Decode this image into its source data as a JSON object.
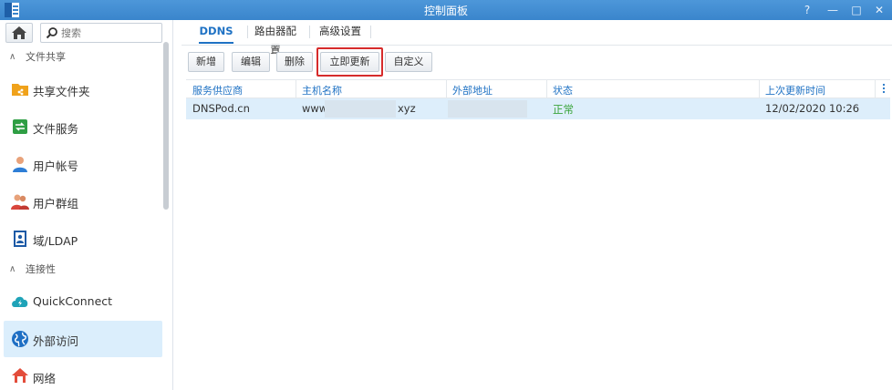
{
  "window": {
    "title": "控制面板",
    "controls": [
      "?",
      "—",
      "□",
      "✕"
    ]
  },
  "sidebar": {
    "search_placeholder": "搜索",
    "sections": [
      {
        "label": "文件共享"
      },
      {
        "label": "连接性"
      }
    ],
    "items": [
      {
        "label": "共享文件夹",
        "icon": "shared-folder-icon"
      },
      {
        "label": "文件服务",
        "icon": "file-services-icon"
      },
      {
        "label": "用户帐号",
        "icon": "user-icon"
      },
      {
        "label": "用户群组",
        "icon": "group-icon"
      },
      {
        "label": "域/LDAP",
        "icon": "ldap-icon"
      },
      {
        "label": "QuickConnect",
        "icon": "quickconnect-icon"
      },
      {
        "label": "外部访问",
        "icon": "globe-icon",
        "active": true
      },
      {
        "label": "网络",
        "icon": "network-icon"
      }
    ]
  },
  "tabs": [
    {
      "label": "DDNS",
      "active": true
    },
    {
      "label": "路由器配置"
    },
    {
      "label": "高级设置"
    }
  ],
  "toolbar": {
    "add": "新增",
    "edit": "编辑",
    "delete": "删除",
    "update_now": "立即更新",
    "customize": "自定义"
  },
  "table": {
    "columns": [
      "服务供应商",
      "主机名称",
      "外部地址",
      "状态",
      "上次更新时间"
    ],
    "rows": [
      {
        "provider": "DNSPod.cn",
        "hostname_prefix": "www",
        "hostname_suffix": "xyz",
        "external_address": "",
        "status": "正常",
        "last_update": "12/02/2020 10:26"
      }
    ]
  },
  "colors": {
    "titlebar": "#3a85cc",
    "accent": "#1f72c4",
    "selected_row": "#ddeefb",
    "status_ok": "#3aa43a",
    "highlight": "#d62b2b"
  }
}
